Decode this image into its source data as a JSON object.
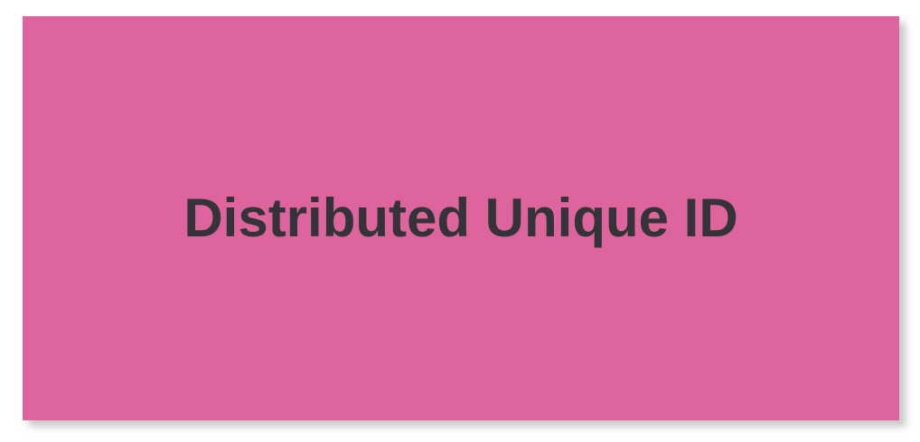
{
  "banner": {
    "title": "Distributed Unique ID",
    "background_color": "#dd649c",
    "text_color": "#35333a"
  }
}
